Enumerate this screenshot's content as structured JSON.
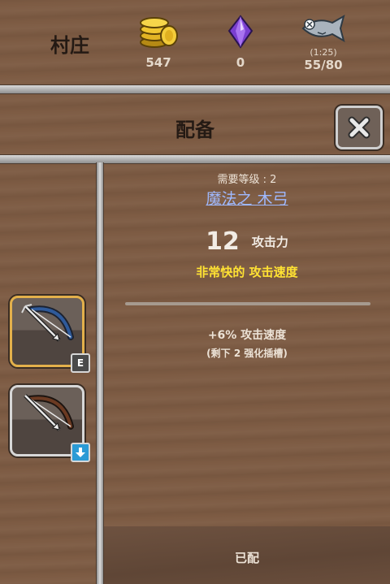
{
  "header": {
    "village_name": "村庄",
    "gold": "547",
    "gems": "0",
    "fish_timer": "(1:25)",
    "fish": "55/80"
  },
  "panel": {
    "title": "配备"
  },
  "item": {
    "required_level": "需要等级 : 2",
    "name": "魔法之 木弓",
    "attack_value": "12",
    "attack_label": "攻击力",
    "attack_speed": "非常快的 攻击速度",
    "bonus": "+6% 攻击速度",
    "slots_left": "(剩下 2 强化插槽)"
  },
  "slots": [
    {
      "icon": "magic-bow-icon",
      "badge": "E"
    },
    {
      "icon": "wooden-bow-icon",
      "badge": "down-arrow-icon"
    }
  ],
  "footer": {
    "equipped_label": "已配"
  },
  "colors": {
    "item_name": "#9fb9ff",
    "attack_speed": "#ffe233",
    "selected_slot_border": "#e3b04b"
  }
}
